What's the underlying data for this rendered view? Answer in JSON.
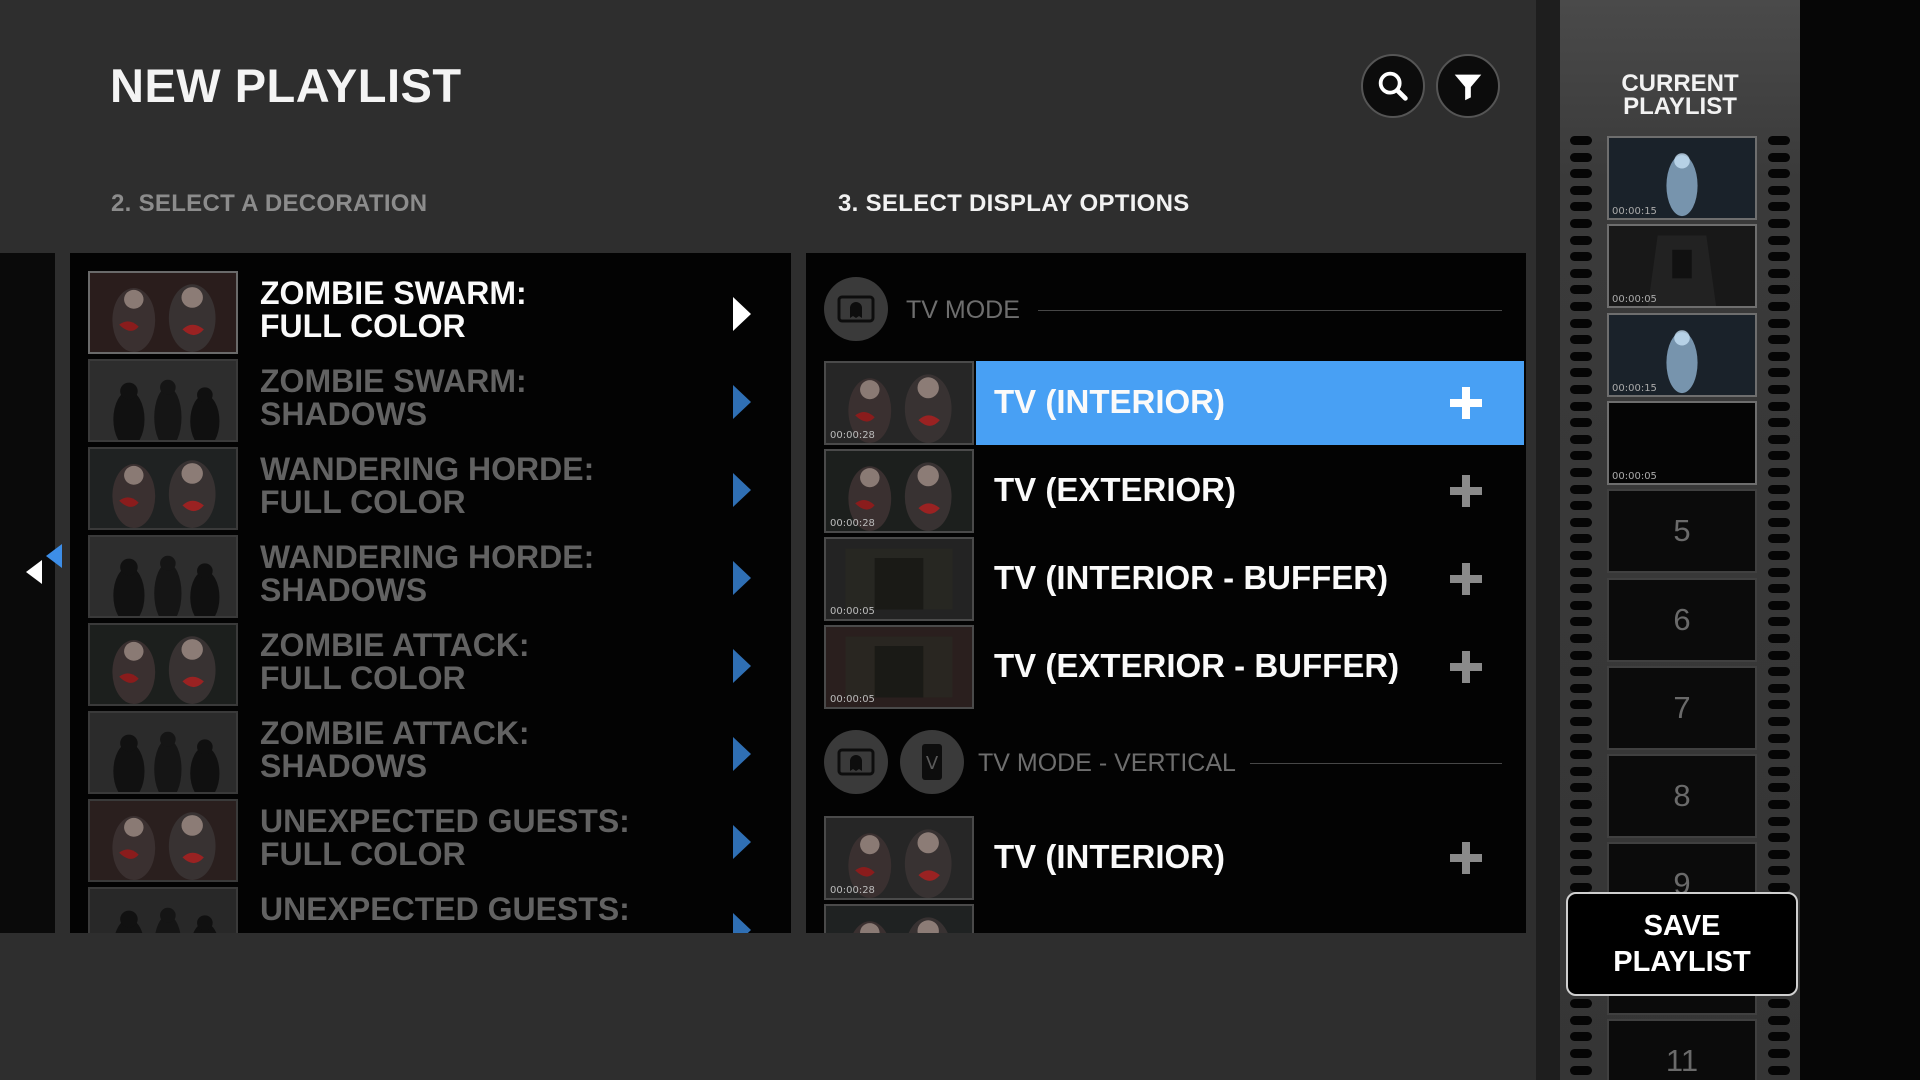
{
  "header": {
    "title": "NEW PLAYLIST"
  },
  "sections": {
    "decoration": "2. SELECT A DECORATION",
    "display": "3. SELECT DISPLAY OPTIONS"
  },
  "decorations": [
    {
      "line1": "ZOMBIE SWARM:",
      "line2": "FULL COLOR",
      "active": true
    },
    {
      "line1": "ZOMBIE SWARM:",
      "line2": "SHADOWS",
      "active": false
    },
    {
      "line1": "WANDERING HORDE:",
      "line2": "FULL COLOR",
      "active": false
    },
    {
      "line1": "WANDERING HORDE:",
      "line2": "SHADOWS",
      "active": false
    },
    {
      "line1": "ZOMBIE ATTACK:",
      "line2": "FULL COLOR",
      "active": false
    },
    {
      "line1": "ZOMBIE ATTACK:",
      "line2": "SHADOWS",
      "active": false
    },
    {
      "line1": "UNEXPECTED GUESTS:",
      "line2": "FULL COLOR",
      "active": false
    },
    {
      "line1": "UNEXPECTED GUESTS:",
      "line2": "",
      "active": false
    }
  ],
  "display_options": {
    "tv_mode": {
      "label": "TV MODE",
      "icon": "tv-ghost-icon",
      "items": [
        {
          "label": "TV (INTERIOR)",
          "duration": "00:00:28",
          "selected": true
        },
        {
          "label": "TV (EXTERIOR)",
          "duration": "00:00:28",
          "selected": false
        },
        {
          "label": "TV (INTERIOR - BUFFER)",
          "duration": "00:00:05",
          "selected": false
        },
        {
          "label": "TV (EXTERIOR - BUFFER)",
          "duration": "00:00:05",
          "selected": false
        }
      ]
    },
    "tv_mode_vertical": {
      "label": "TV MODE - VERTICAL",
      "icons": [
        "tv-ghost-icon",
        "vertical-v-icon"
      ],
      "badge": "V",
      "items": [
        {
          "label": "TV (INTERIOR)",
          "duration": "00:00:28",
          "selected": false
        }
      ]
    }
  },
  "current_playlist": {
    "title_line1": "CURRENT",
    "title_line2": "PLAYLIST",
    "slots": [
      {
        "number": "",
        "duration": "00:00:15",
        "filled": true
      },
      {
        "number": "",
        "duration": "00:00:05",
        "filled": true
      },
      {
        "number": "",
        "duration": "00:00:15",
        "filled": true
      },
      {
        "number": "",
        "duration": "00:00:05",
        "filled": true
      },
      {
        "number": "5",
        "duration": "",
        "filled": false
      },
      {
        "number": "6",
        "duration": "",
        "filled": false
      },
      {
        "number": "7",
        "duration": "",
        "filled": false
      },
      {
        "number": "8",
        "duration": "",
        "filled": false
      },
      {
        "number": "9",
        "duration": "",
        "filled": false
      },
      {
        "number": "",
        "duration": "",
        "filled": false
      },
      {
        "number": "11",
        "duration": "",
        "filled": false
      }
    ],
    "save_line1": "SAVE",
    "save_line2": "PLAYLIST"
  },
  "colors": {
    "accent": "#48a0f4",
    "nav_arrow_active": "#3d8ee8",
    "background": "#2e2e2e",
    "panel": "#030303"
  }
}
